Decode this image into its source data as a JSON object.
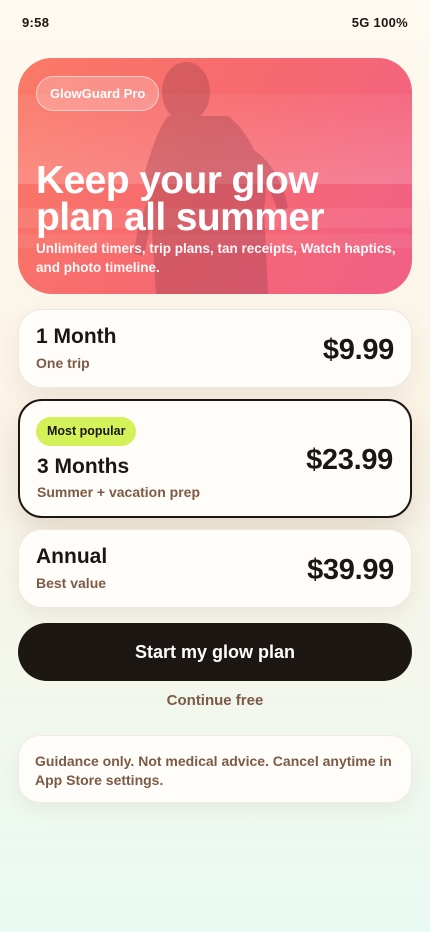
{
  "status_bar": {
    "time": "9:58",
    "signal": "5G 100%"
  },
  "hero": {
    "chip": "GlowGuard Pro",
    "title_line1": "Keep your glow",
    "title_line2": "plan all summer",
    "subtitle": "Unlimited timers, trip plans, tan receipts, Watch haptics, and photo timeline."
  },
  "plans": [
    {
      "name": "1 Month",
      "description": "One trip",
      "price": "$9.99"
    },
    {
      "name": "3 Months",
      "description": "Summer + vacation prep",
      "price": "$23.99",
      "badge": "Most popular"
    },
    {
      "name": "Annual",
      "description": "Best value",
      "price": "$39.99"
    }
  ],
  "cta_label": "Start my glow plan",
  "continue_label": "Continue free",
  "disclaimer": "Guidance only. Not medical advice. Cancel anytime in App Store settings.",
  "colors": {
    "accent_dark": "#1d1714",
    "badge": "#d5f15a",
    "hero_start": "#fb7a66",
    "hero_end": "#f15f86",
    "muted_text": "#7c5a45"
  }
}
